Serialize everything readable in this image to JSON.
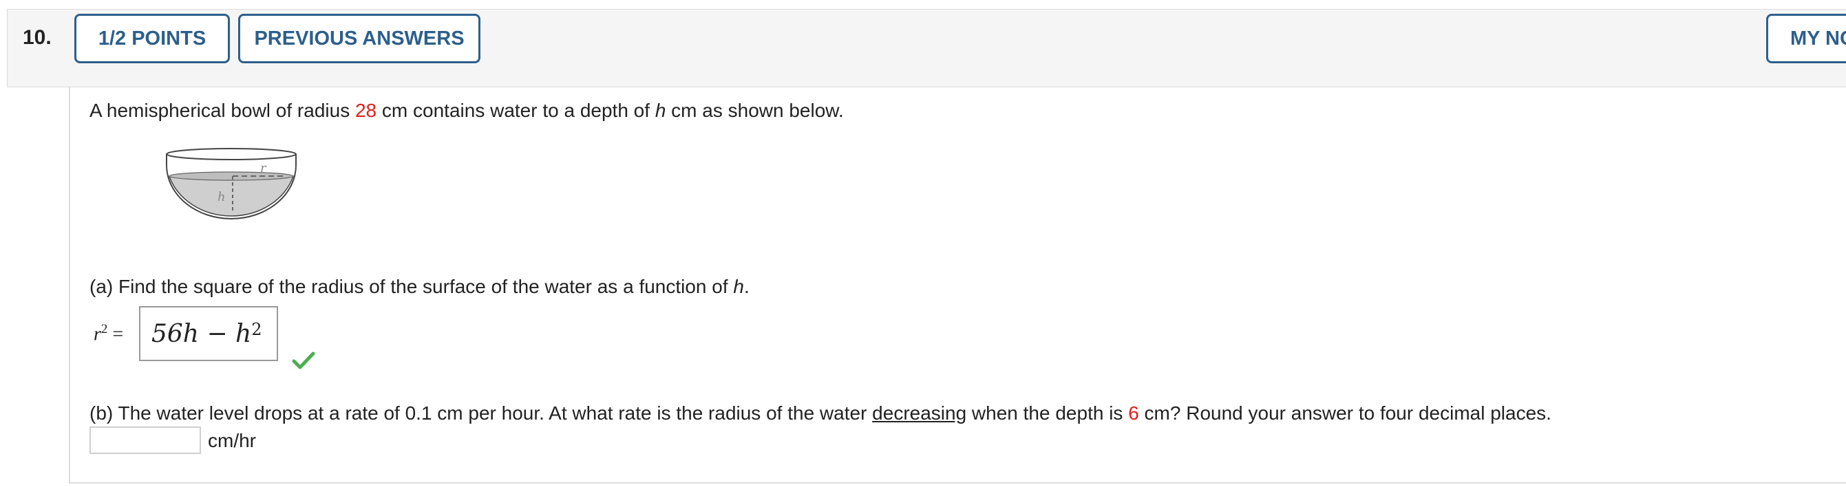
{
  "header": {
    "question_number": "10.",
    "points_label": "1/2 POINTS",
    "previous_answers_label": "PREVIOUS ANSWERS",
    "my_notes_label": "MY NOTES"
  },
  "problem": {
    "intro_before": "A hemispherical bowl of radius ",
    "radius_value": "28",
    "intro_mid": " cm contains water to a depth of ",
    "h_var": "h",
    "intro_after": " cm as shown below.",
    "figure_label_r": "r",
    "figure_label_h": "h"
  },
  "part_a": {
    "prompt_before": "(a) Find the square of the radius of the surface of the water as a function of ",
    "h_var": "h",
    "prompt_after": ".",
    "lhs_base": "r",
    "lhs_exp": "2",
    "lhs_equals": " =",
    "answer_base": "56h − h",
    "answer_exp": "2",
    "status": "correct"
  },
  "part_b": {
    "prompt_before": "(b) The water level drops at a rate of 0.1 cm per hour. At what rate is the radius of the water ",
    "underlined_word": "decreasing",
    "prompt_mid": " when the depth is ",
    "depth_value": "6",
    "prompt_after": " cm? Round your answer to four decimal places.",
    "answer_value": "",
    "unit": "cm/hr"
  },
  "colors": {
    "accent": "#2d5f8c",
    "highlight_red": "#e0201b",
    "check_green": "#4caf50"
  }
}
